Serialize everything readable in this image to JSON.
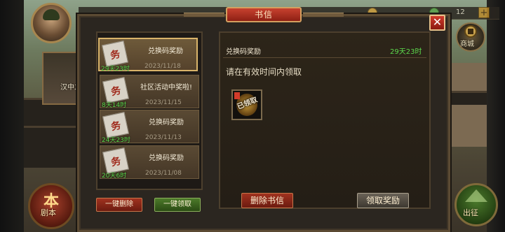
{
  "dialog": {
    "title": "书信",
    "close_symbol": "✕"
  },
  "hud": {
    "resource_count": "12",
    "plus_symbol": "+",
    "side_banner_label": "汉中之",
    "shop_label": "商城",
    "script_label": "剧本",
    "script_glyph": "本",
    "march_label": "出征"
  },
  "mail_list": {
    "items": [
      {
        "title": "兑换码奖励",
        "timer": "29天23时",
        "date": "2023/11/18",
        "selected": true
      },
      {
        "title": "社区活动中奖啦!",
        "timer": "8天14时",
        "date": "2023/11/15",
        "selected": false
      },
      {
        "title": "兑换码奖励",
        "timer": "24天23时",
        "date": "2023/11/13",
        "selected": false
      },
      {
        "title": "兑换码奖励",
        "timer": "20天6时",
        "date": "2023/11/08",
        "selected": false
      }
    ],
    "icon_glyph": "务",
    "delete_all_label": "一键删除",
    "claim_all_label": "一键领取"
  },
  "detail": {
    "title": "兑换码奖励",
    "timer": "29天23时",
    "body": "请在有效时间内领取",
    "reward_status": "已领取",
    "delete_label": "删除书信",
    "claim_label": "领取奖励"
  },
  "colors": {
    "timer_green": "#5cd84c",
    "title_red": "#c8422f",
    "selected_border": "#d9b46a"
  },
  "icons": {
    "close": "close-icon",
    "mail": "mail-scroll-icon",
    "reward": "reward-item-icon",
    "shop": "shop-icon",
    "script": "script-icon",
    "march": "march-icon"
  }
}
